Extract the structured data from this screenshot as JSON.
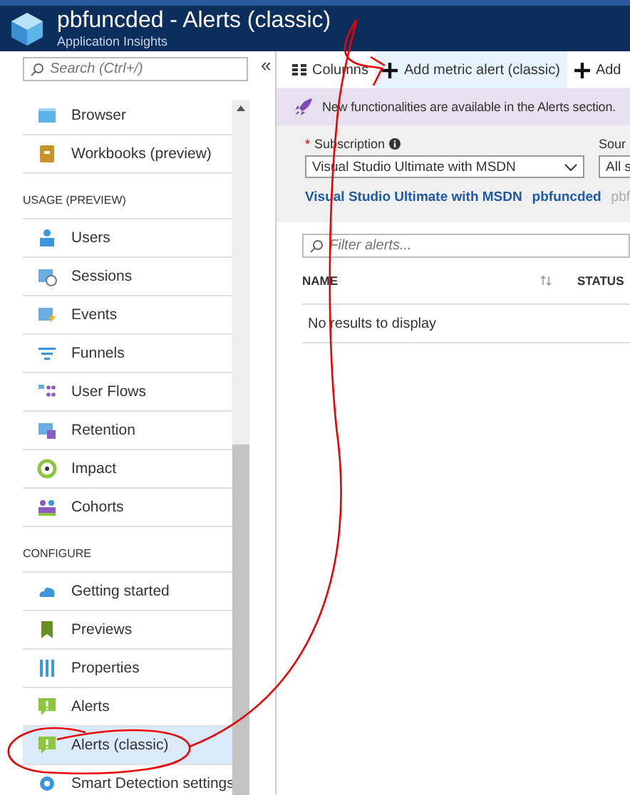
{
  "header": {
    "title": "pbfuncded - Alerts (classic)",
    "subtitle": "Application Insights"
  },
  "sidebar": {
    "search": {
      "placeholder": "Search (Ctrl+/)"
    },
    "collapse": "«",
    "rows": [
      {
        "kind": "item",
        "label": "Browser",
        "selected": false
      },
      {
        "kind": "item",
        "label": "Workbooks (preview)",
        "selected": false
      },
      {
        "kind": "header",
        "label": "USAGE (PREVIEW)"
      },
      {
        "kind": "item",
        "label": "Users",
        "selected": false
      },
      {
        "kind": "item",
        "label": "Sessions",
        "selected": false
      },
      {
        "kind": "item",
        "label": "Events",
        "selected": false
      },
      {
        "kind": "item",
        "label": "Funnels",
        "selected": false
      },
      {
        "kind": "item",
        "label": "User Flows",
        "selected": false
      },
      {
        "kind": "item",
        "label": "Retention",
        "selected": false
      },
      {
        "kind": "item",
        "label": "Impact",
        "selected": false
      },
      {
        "kind": "item",
        "label": "Cohorts",
        "selected": false
      },
      {
        "kind": "header",
        "label": "CONFIGURE"
      },
      {
        "kind": "item",
        "label": "Getting started",
        "selected": false
      },
      {
        "kind": "item",
        "label": "Previews",
        "selected": false
      },
      {
        "kind": "item",
        "label": "Properties",
        "selected": false
      },
      {
        "kind": "item",
        "label": "Alerts",
        "selected": false
      },
      {
        "kind": "item",
        "label": "Alerts (classic)",
        "selected": true
      },
      {
        "kind": "item",
        "label": "Smart Detection settings",
        "selected": false
      }
    ]
  },
  "toolbar": [
    {
      "label": "Columns",
      "highlighted": false
    },
    {
      "label": "Add metric alert (classic)",
      "highlighted": true
    },
    {
      "label": "Add",
      "highlighted": false
    }
  ],
  "banner": "New functionalities are available in the Alerts section.",
  "filters": {
    "required_mark": "*",
    "subscription_label": "Subscription",
    "subscription_value": "Visual Studio Ultimate with MSDN",
    "source_label": "Sour",
    "source_value": "All s"
  },
  "breadcrumb": [
    {
      "label": "Visual Studio Ultimate with MSDN",
      "link": true
    },
    {
      "label": "pbfuncded",
      "link": true
    },
    {
      "label": "pbf",
      "link": false
    }
  ],
  "filter_field": {
    "placeholder": "Filter alerts..."
  },
  "table": {
    "columns": [
      "NAME",
      "STATUS"
    ],
    "empty": "No results to display"
  }
}
